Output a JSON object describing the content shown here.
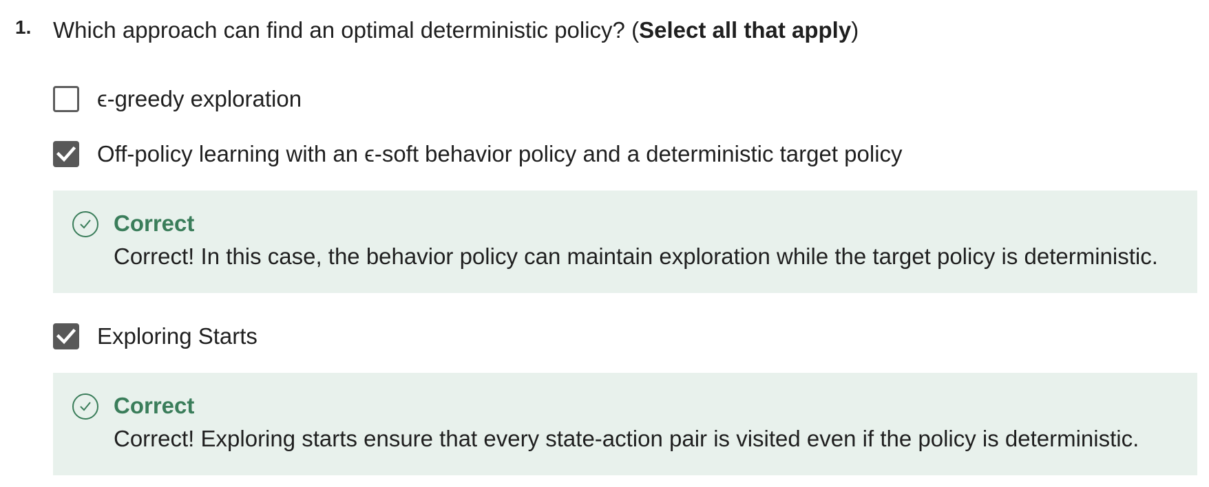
{
  "question": {
    "number": "1.",
    "text_main": "Which approach can find an optimal deterministic policy? (",
    "text_emphasis": "Select all that apply",
    "text_end": ")"
  },
  "options": [
    {
      "label": "ϵ-greedy exploration",
      "checked": false
    },
    {
      "label": "Off-policy learning with an ϵ-soft behavior policy and a deterministic target policy",
      "checked": true
    },
    {
      "label": "Exploring Starts",
      "checked": true
    }
  ],
  "feedback": [
    {
      "title": "Correct",
      "text": "Correct! In this case, the behavior policy can maintain exploration while the target policy is deterministic."
    },
    {
      "title": "Correct",
      "text": "Correct! Exploring starts ensure that every state-action pair is visited even if the policy is deterministic."
    }
  ],
  "colors": {
    "checkbox_checked": "#585858",
    "checkbox_border": "#5b5b5b",
    "feedback_bg": "#e8f1ec",
    "correct_green": "#3a7d5a"
  },
  "icons": {
    "checkmark": "check-icon",
    "correct": "circle-check-icon"
  }
}
